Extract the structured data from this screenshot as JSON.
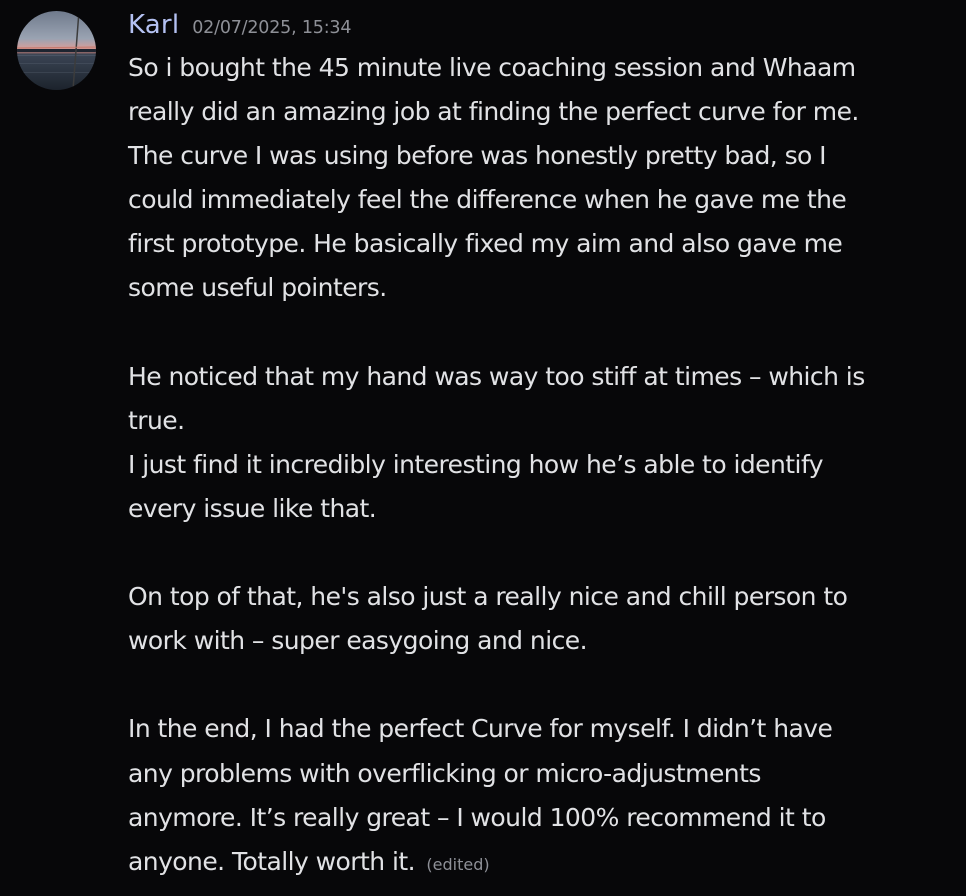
{
  "message": {
    "author": "Karl",
    "timestamp": "02/07/2025, 15:34",
    "edited_label": "(edited)",
    "lines": [
      "So i bought the 45 minute live coaching session and Whaam",
      "really did an amazing job at finding the perfect curve for me.",
      "The curve I was using before was honestly pretty bad, so I",
      "could immediately feel the difference when he gave me the",
      "first prototype. He basically fixed my aim and also gave me",
      "some useful pointers.",
      "",
      "He noticed that my hand was way too stiff at times – which is",
      "true.",
      "I just find it incredibly interesting how he’s able to identify",
      "every issue like that.",
      "",
      "On top of that, he's also just a really nice and chill person to",
      "work with – super easygoing and nice.",
      "",
      "In the end, I had the perfect Curve for myself. I didn’t have",
      "any problems with overflicking or micro-adjustments",
      "anymore. It’s really great – I would 100% recommend it to",
      "anyone. Totally worth it."
    ]
  },
  "colors": {
    "background": "#070709",
    "username": "#b4c1f2",
    "text": "#e1e2e5",
    "muted": "#8e9097"
  }
}
